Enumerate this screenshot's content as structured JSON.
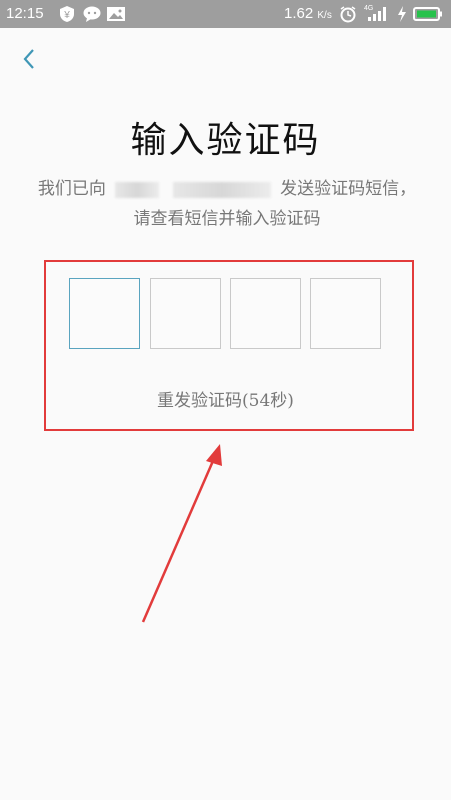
{
  "status_bar": {
    "time": "12:15",
    "speed_value": "1.62",
    "speed_unit": "K/s",
    "network": "4G"
  },
  "header": {
    "back_icon": "chevron-left-icon"
  },
  "main": {
    "title": "输入验证码",
    "desc_prefix": "我们已向",
    "desc_suffix": "发送验证码短信，请查看短信并输入验证码",
    "code_boxes": [
      "",
      "",
      "",
      ""
    ],
    "resend_label": "重发验证码(54秒)"
  },
  "colors": {
    "accent": "#5aa4bf",
    "annotation": "#e23b3b",
    "status_bar": "#9e9e9e"
  }
}
